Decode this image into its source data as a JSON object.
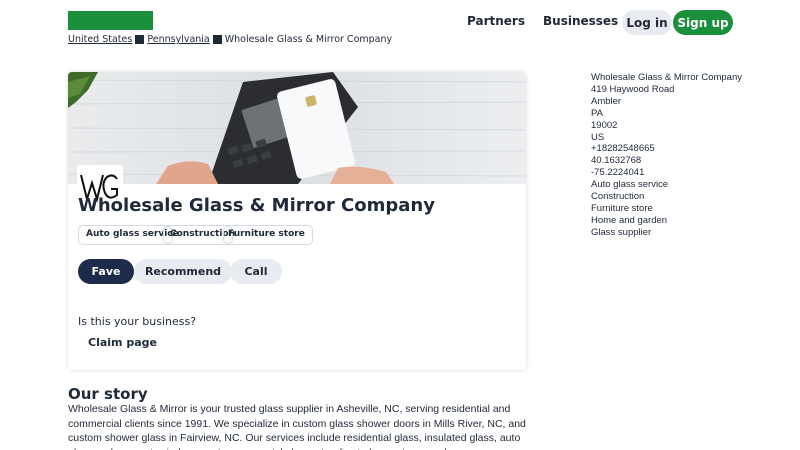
{
  "header": {
    "nav": {
      "partners": "Partners",
      "businesses": "Businesses"
    },
    "login": "Log in",
    "signup": "Sign up",
    "brand_color": "#1a8f3c"
  },
  "breadcrumb": {
    "country": "United States",
    "state": "Pennsylvania",
    "current": "Wholesale Glass & Mirror Company"
  },
  "business": {
    "name": "Wholesale Glass & Mirror Company",
    "logo_text": "WG",
    "tags": [
      "Auto glass service",
      "Construction",
      "Furniture store"
    ],
    "actions": {
      "fave": "Fave",
      "recommend": "Recommend",
      "call": "Call"
    },
    "claim_question": "Is this your business?",
    "claim_link": "Claim page"
  },
  "story": {
    "heading": "Our story",
    "text": "Wholesale Glass & Mirror is your trusted glass supplier in Asheville, NC, serving residential and commercial clients since 1991. We specialize in custom glass shower doors in Mills River, NC, and custom shower glass in Fairview, NC. Our services include residential glass, insulated glass, auto glass replacement, window repair, commercial glass, storefront glass, mirrors and more."
  },
  "sidebar": {
    "lines": [
      "Wholesale Glass & Mirror Company",
      "419 Haywood Road",
      "Ambler",
      "PA",
      "19002",
      "US",
      "+18282548665",
      "40.1632768",
      "-75.2224041",
      "Auto glass service",
      "Construction",
      "Furniture store",
      "Home and garden",
      "Glass supplier"
    ]
  }
}
